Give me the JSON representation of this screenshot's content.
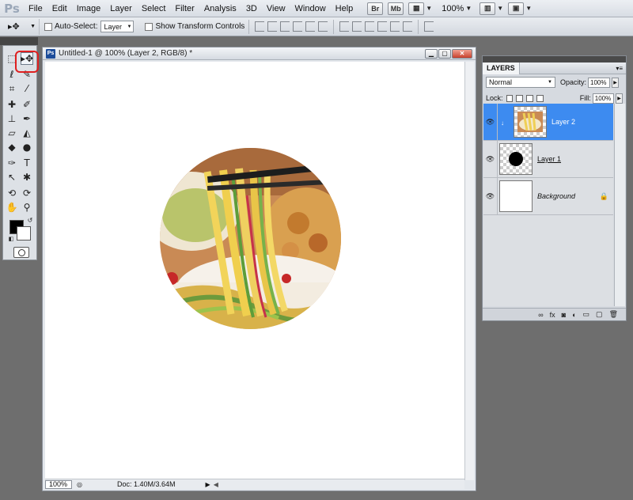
{
  "app": {
    "logo": "Ps"
  },
  "menu": [
    "File",
    "Edit",
    "Image",
    "Layer",
    "Select",
    "Filter",
    "Analysis",
    "3D",
    "View",
    "Window",
    "Help"
  ],
  "menubar_buttons": {
    "bridge": "Br",
    "minibridge": "Mb",
    "zoom": "100%"
  },
  "options": {
    "auto_select_label": "Auto-Select:",
    "auto_select_value": "Layer",
    "show_transform_label": "Show Transform Controls"
  },
  "document": {
    "badge": "Ps",
    "title": "Untitled-1 @ 100% (Layer 2, RGB/8) *",
    "zoom": "100%",
    "doc_info": "Doc: 1.40M/3.64M"
  },
  "layers_panel": {
    "tab": "LAYERS",
    "blend_mode": "Normal",
    "opacity_label": "Opacity:",
    "opacity_value": "100%",
    "lock_label": "Lock:",
    "fill_label": "Fill:",
    "fill_value": "100%",
    "layers": [
      {
        "name": "Layer 2"
      },
      {
        "name": "Layer 1"
      },
      {
        "name": "Background"
      }
    ]
  },
  "colors": {
    "selected_layer": "#3d8bf0",
    "highlight": "#e02020",
    "workspace": "#6e6e6e"
  }
}
